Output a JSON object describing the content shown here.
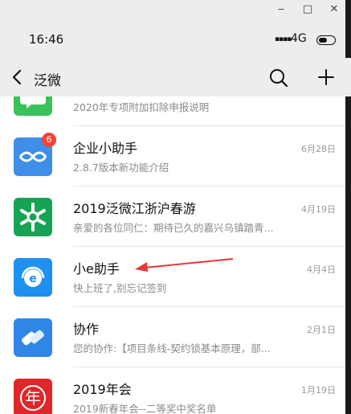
{
  "window": {
    "minimize": "‒",
    "maximize": "□",
    "close": "✕"
  },
  "status": {
    "time": "16:46",
    "signal": "▪▪▪▪",
    "network": "4G"
  },
  "header": {
    "title": "泛微",
    "back_icon": "chevron-left-icon",
    "search_icon": "search-icon",
    "add_icon": "plus-icon"
  },
  "items": [
    {
      "name": "",
      "sub": "2020年专项附加扣除申报说明",
      "date": "",
      "color": "#3ac25a",
      "icon": "chat-icon",
      "badge": ""
    },
    {
      "name": "企业小助手",
      "sub": "2.8.7版本新功能介绍",
      "date": "6月28日",
      "color": "#3f8ee8",
      "icon": "link-icon",
      "badge": "6"
    },
    {
      "name": "2019泛微江浙沪春游",
      "sub": "亲爱的各位同仁：期待已久的嘉兴乌镇踏青...",
      "date": "4月19日",
      "color": "#17a255",
      "icon": "snowflake-icon",
      "badge": ""
    },
    {
      "name": "小e助手",
      "sub": "快上班了,别忘记签到",
      "date": "4月4日",
      "color": "#1e90f0",
      "icon": "headset-icon",
      "badge": ""
    },
    {
      "name": "协作",
      "sub": "您的协作:【项目条线-契约锁基本原理，部...",
      "date": "2月1日",
      "color": "#2f86e6",
      "icon": "handshake-icon",
      "badge": ""
    },
    {
      "name": "2019年会",
      "sub": "2019新春年会--二等奖中奖名单",
      "date": "1月19日",
      "color": "#e0262a",
      "icon": "nian-icon",
      "avatar_text": "年",
      "badge": ""
    }
  ]
}
